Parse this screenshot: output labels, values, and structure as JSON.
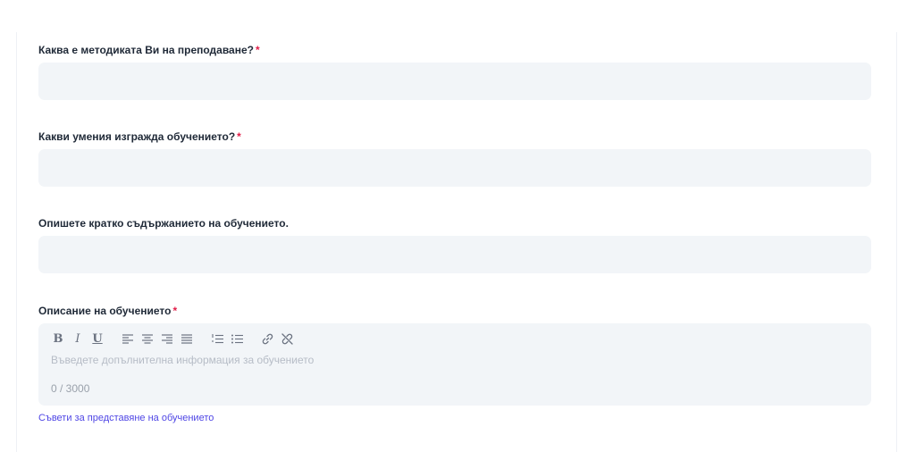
{
  "form": {
    "fields": [
      {
        "label": "Каква е методиката Ви на преподаване?",
        "required_mark": "*",
        "value": ""
      },
      {
        "label": "Какви умения изгражда обучението?",
        "required_mark": "*",
        "value": ""
      },
      {
        "label": "Опишете кратко съдържанието на обучението.",
        "value": ""
      }
    ],
    "description": {
      "label": "Описание на обучението",
      "required_mark": "*",
      "placeholder": "Въведете допълнителна информация за обучението",
      "counter": "0 / 3000",
      "toolbar": [
        {
          "name": "bold",
          "glyph": "B"
        },
        {
          "name": "italic",
          "glyph": "I"
        },
        {
          "name": "underline",
          "glyph": "U"
        },
        {
          "name": "align-left",
          "glyph": "≡"
        },
        {
          "name": "align-center",
          "glyph": "≡"
        },
        {
          "name": "align-right",
          "glyph": "≡"
        },
        {
          "name": "align-justify",
          "glyph": "≣"
        },
        {
          "name": "ordered-list",
          "glyph": "⒈"
        },
        {
          "name": "bullet-list",
          "glyph": "☰"
        },
        {
          "name": "link",
          "glyph": "🔗"
        },
        {
          "name": "unlink",
          "glyph": "✂"
        }
      ]
    },
    "tips_link": "Съвети за представяне на обучението"
  },
  "colors": {
    "required": "#e11d48",
    "input_bg": "#f2f5f8",
    "link": "#4f46e5"
  }
}
